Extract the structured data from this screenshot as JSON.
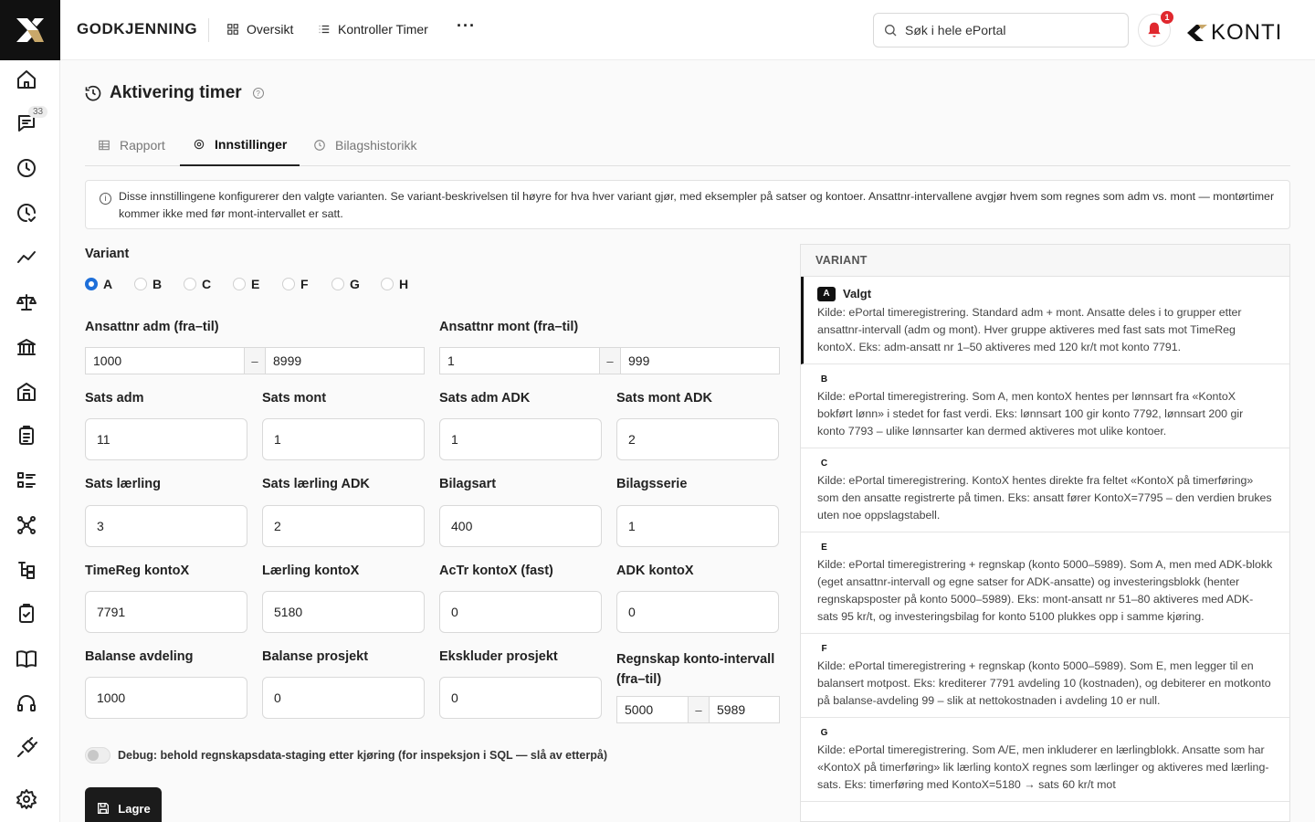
{
  "nav": {
    "messages_badge": "33"
  },
  "header": {
    "brand": "GODKJENNING",
    "links": [
      {
        "label": "Oversikt"
      },
      {
        "label": "Kontroller Timer"
      }
    ],
    "more": "···",
    "search_placeholder": "Søk i hele ePortal",
    "notifications_count": "1",
    "logo_text": "KONTI"
  },
  "page": {
    "title": "Aktivering timer",
    "help": "?",
    "tabs": [
      {
        "label": "Rapport"
      },
      {
        "label": "Innstillinger"
      },
      {
        "label": "Bilagshistorikk"
      }
    ],
    "info": "Disse innstillingene konfigurerer den valgte varianten. Se variant-beskrivelsen til høyre for hva hver variant gjør, med eksempler på satser og kontoer. Ansattnr-intervallene avgjør hvem som regnes som adm vs. mont — montørtimer kommer ikke med før mont-intervallet er satt."
  },
  "form": {
    "variant_label": "Variant",
    "variants": [
      "A",
      "B",
      "C",
      "E",
      "F",
      "G",
      "H"
    ],
    "selected_variant": "A",
    "adm_range": {
      "label": "Ansattnr adm (fra–til)",
      "from": "1000",
      "to": "8999"
    },
    "mont_range": {
      "label": "Ansattnr mont (fra–til)",
      "from": "1",
      "to": "999"
    },
    "dash": "–",
    "fields": {
      "sats_adm": {
        "label": "Sats adm",
        "value": "11"
      },
      "sats_mont": {
        "label": "Sats mont",
        "value": "1"
      },
      "sats_adm_adk": {
        "label": "Sats adm ADK",
        "value": "1"
      },
      "sats_mont_adk": {
        "label": "Sats mont ADK",
        "value": "2"
      },
      "sats_laerling": {
        "label": "Sats lærling",
        "value": "3"
      },
      "sats_laerling_adk": {
        "label": "Sats lærling ADK",
        "value": "2"
      },
      "bilagsart": {
        "label": "Bilagsart",
        "value": "400"
      },
      "bilagsserie": {
        "label": "Bilagsserie",
        "value": "1"
      },
      "timereg_kontox": {
        "label": "TimeReg kontoX",
        "value": "7791"
      },
      "laerling_kontox": {
        "label": "Lærling kontoX",
        "value": "5180"
      },
      "actr_kontox": {
        "label": "AcTr kontoX (fast)",
        "value": "0"
      },
      "adk_kontox": {
        "label": "ADK kontoX",
        "value": "0"
      },
      "balanse_avdeling": {
        "label": "Balanse avdeling",
        "value": "1000"
      },
      "balanse_prosjekt": {
        "label": "Balanse prosjekt",
        "value": "0"
      },
      "ekskluder_prosjekt": {
        "label": "Ekskluder prosjekt",
        "value": "0"
      }
    },
    "regnskap_range": {
      "label_line1": "Regnskap konto-intervall",
      "label_line2": "(fra–til)",
      "from": "5000",
      "to": "5989"
    },
    "debug_label": "Debug: behold regnskapsdata-staging etter kjøring (for inspeksjon i SQL — slå av etterpå)",
    "save_label": "Lagre"
  },
  "variant_panel": {
    "title": "VARIANT",
    "chosen_label": "Valgt",
    "items": [
      {
        "id": "A",
        "desc": "Kilde: ePortal timeregistrering. Standard adm + mont. Ansatte deles i to grupper etter ansattnr-intervall (adm og mont). Hver gruppe aktiveres med fast sats mot TimeReg kontoX. Eks: adm-ansatt nr 1–50 aktiveres med 120 kr/t mot konto 7791."
      },
      {
        "id": "B",
        "desc": "Kilde: ePortal timeregistrering. Som A, men kontoX hentes per lønnsart fra «KontoX bokført lønn» i stedet for fast verdi. Eks: lønnsart 100 gir konto 7792, lønnsart 200 gir konto 7793 – ulike lønnsarter kan dermed aktiveres mot ulike kontoer."
      },
      {
        "id": "C",
        "desc": "Kilde: ePortal timeregistrering. KontoX hentes direkte fra feltet «KontoX på timerføring» som den ansatte registrerte på timen. Eks: ansatt fører KontoX=7795 – den verdien brukes uten noe oppslagstabell."
      },
      {
        "id": "E",
        "desc": "Kilde: ePortal timeregistrering + regnskap (konto 5000–5989). Som A, men med ADK-blokk (eget ansattnr-intervall og egne satser for ADK-ansatte) og investeringsblokk (henter regnskapsposter på konto 5000–5989). Eks: mont-ansatt nr 51–80 aktiveres med ADK-sats 95 kr/t, og investeringsbilag for konto 5100 plukkes opp i samme kjøring."
      },
      {
        "id": "F",
        "desc": "Kilde: ePortal timeregistrering + regnskap (konto 5000–5989). Som E, men legger til en balansert motpost. Eks: krediterer 7791 avdeling 10 (kostnaden), og debiterer en motkonto på balanse-avdeling 99 – slik at nettokostnaden i avdeling 10 er null."
      },
      {
        "id": "G",
        "desc": "Kilde: ePortal timeregistrering. Som A/E, men inkluderer en lærlingblokk. Ansatte som har «KontoX på timerføring» lik lærling kontoX regnes som lærlinger og aktiveres med lærling-sats. Eks: timerføring med KontoX=5180 → sats 60 kr/t mot"
      }
    ]
  }
}
